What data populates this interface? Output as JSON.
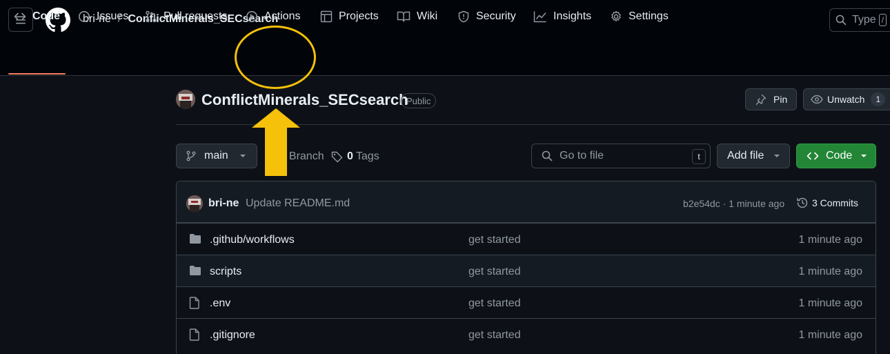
{
  "header": {
    "owner": "bri-ne",
    "separator": "/",
    "repo": "ConflictMinerals_SECsearch",
    "search_placeholder": "Type",
    "search_shortcut": "/"
  },
  "tabs": [
    {
      "label": "Code",
      "icon": "code-icon",
      "active": true
    },
    {
      "label": "Issues",
      "icon": "issue-icon"
    },
    {
      "label": "Pull requests",
      "icon": "pull-request-icon"
    },
    {
      "label": "Actions",
      "icon": "play-icon"
    },
    {
      "label": "Projects",
      "icon": "table-icon"
    },
    {
      "label": "Wiki",
      "icon": "book-icon"
    },
    {
      "label": "Security",
      "icon": "shield-icon"
    },
    {
      "label": "Insights",
      "icon": "graph-icon"
    },
    {
      "label": "Settings",
      "icon": "gear-icon"
    }
  ],
  "repo_header": {
    "title": "ConflictMinerals_SECsearch",
    "visibility": "Public",
    "pin_label": "Pin",
    "watch_label": "Unwatch",
    "watch_count": "1"
  },
  "toolbar": {
    "branch": "main",
    "branch_count": "1",
    "branch_word": "Branch",
    "tag_count": "0",
    "tag_word": "Tags",
    "goto_placeholder": "Go to file",
    "goto_shortcut": "t",
    "add_file_label": "Add file",
    "code_label": "Code"
  },
  "latest_commit": {
    "author": "bri-ne",
    "message": "Update README.md",
    "hash_time": "b2e54dc · 1 minute ago",
    "commits_label": "3 Commits"
  },
  "files": [
    {
      "name": ".github/workflows",
      "type": "folder",
      "message": "get started",
      "time": "1 minute ago"
    },
    {
      "name": "scripts",
      "type": "folder",
      "message": "get started",
      "time": "1 minute ago"
    },
    {
      "name": ".env",
      "type": "file",
      "message": "get started",
      "time": "1 minute ago"
    },
    {
      "name": ".gitignore",
      "type": "file",
      "message": "get started",
      "time": "1 minute ago"
    }
  ],
  "colors": {
    "background": "#0d1117",
    "header_bg": "#010409",
    "accent_underline": "#f78166",
    "code_button": "#238636",
    "annotation": "#f5c10a"
  }
}
